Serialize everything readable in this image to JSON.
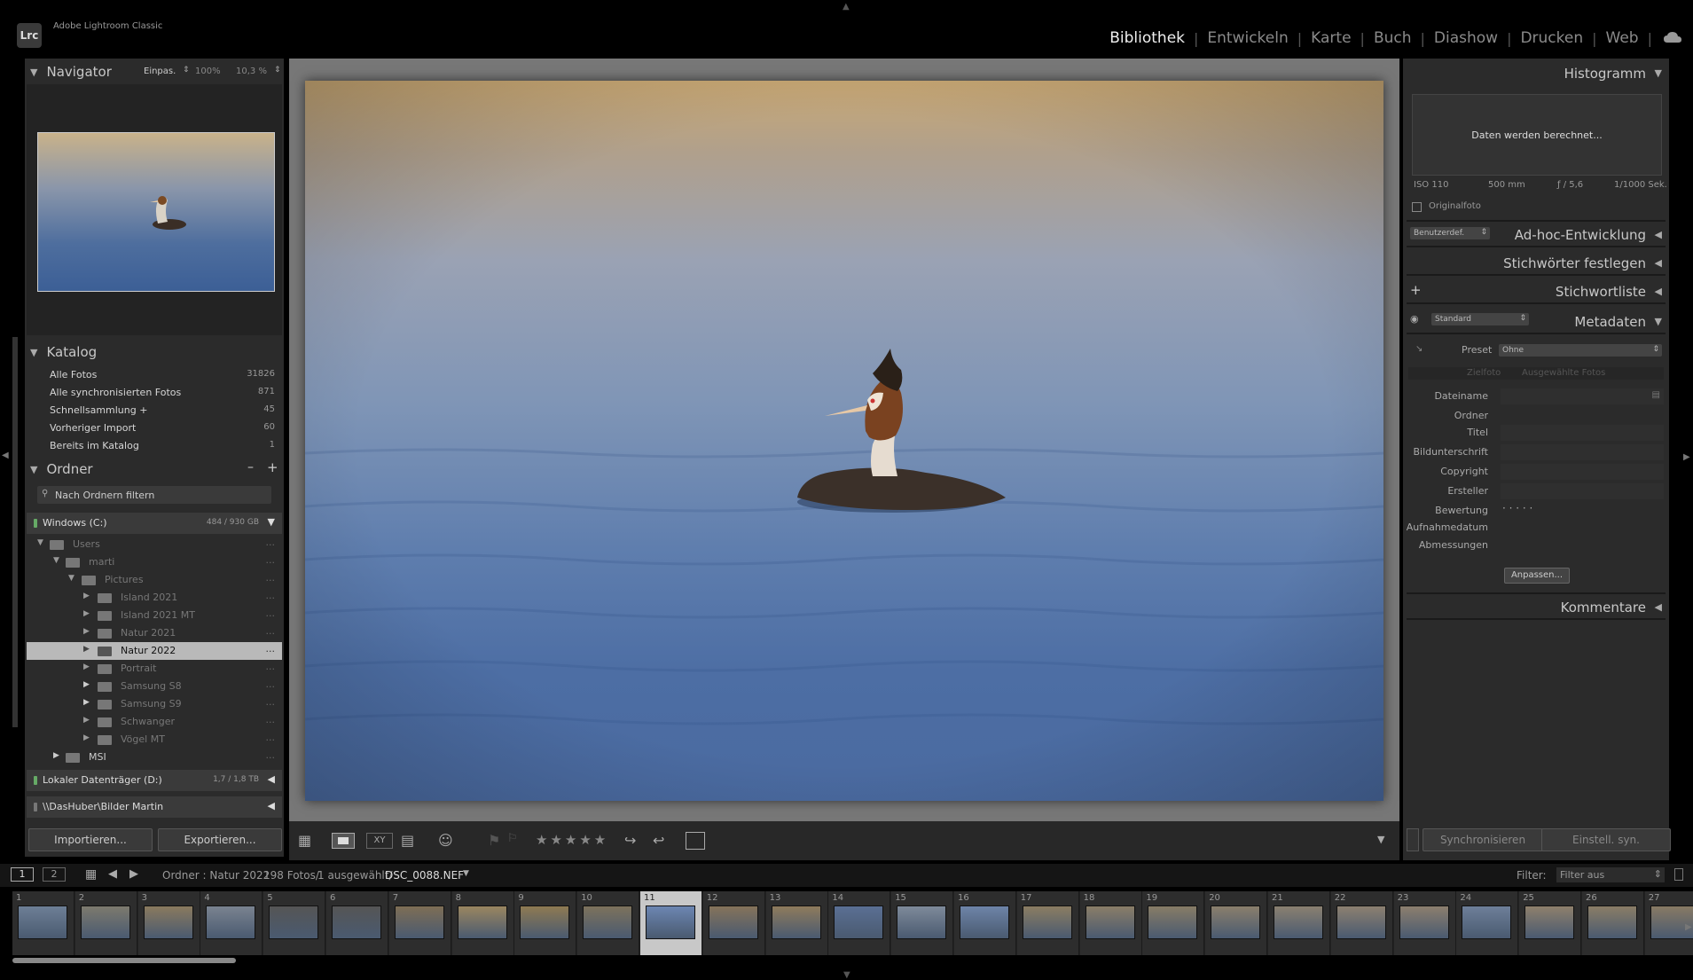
{
  "app": {
    "name": "Adobe Lightroom Classic",
    "logo": "Lrc"
  },
  "modules": [
    "Bibliothek",
    "Entwickeln",
    "Karte",
    "Buch",
    "Diashow",
    "Drucken",
    "Web"
  ],
  "active_module": "Bibliothek",
  "navigator": {
    "title": "Navigator",
    "fit": "Einpas.",
    "zoom1": "100%",
    "zoom2": "10,3 %"
  },
  "catalog": {
    "title": "Katalog",
    "items": [
      {
        "label": "Alle Fotos",
        "count": "31826"
      },
      {
        "label": "Alle synchronisierten Fotos",
        "count": "871"
      },
      {
        "label": "Schnellsammlung  +",
        "count": "45"
      },
      {
        "label": "Vorheriger Import",
        "count": "60"
      },
      {
        "label": "Bereits im Katalog",
        "count": "1"
      }
    ]
  },
  "folders": {
    "title": "Ordner",
    "minus": "–",
    "plus": "+",
    "filter_placeholder": "Nach Ordnern filtern",
    "volume_c": {
      "label": "Windows (C:)",
      "size": "484 / 930 GB"
    },
    "tree": [
      "Users",
      "marti",
      "Pictures",
      "Island 2021",
      "Island 2021 MT",
      "Natur 2021",
      "Natur 2022",
      "Portrait",
      "Samsung S8",
      "Samsung S9",
      "Schwanger",
      "Vögel MT",
      "MSI"
    ],
    "volume_d": {
      "label": "Lokaler Datenträger (D:)",
      "size": "1,7 / 1,8 TB"
    },
    "network": {
      "label": "\\\\DasHuber\\Bilder Martin"
    }
  },
  "buttons": {
    "import": "Importieren...",
    "export": "Exportieren...",
    "sync": "Synchronisieren",
    "sync_settings": "Einstell. syn."
  },
  "right": {
    "histogram": "Histogramm",
    "calc": "Daten werden berechnet...",
    "exif": {
      "iso": "ISO 110",
      "focal": "500 mm",
      "aperture": "ƒ / 5,6",
      "shutter": "1/1000 Sek."
    },
    "original": "Originalfoto",
    "quick_preset": "Benutzerdef.",
    "quick_dev": "Ad-hoc-Entwicklung",
    "keywording": "Stichwörter festlegen",
    "keyword_list": "Stichwortliste",
    "metadata": "Metadaten",
    "meta_view": "Standard",
    "preset_label": "Preset",
    "preset_value": "Ohne",
    "tab_target": "Zielfoto",
    "tab_selected": "Ausgewählte Fotos",
    "fields": [
      "Dateiname",
      "Ordner",
      "Titel",
      "Bildunterschrift",
      "Copyright",
      "Ersteller",
      "Bewertung",
      "Aufnahmedatum",
      "Abmessungen"
    ],
    "rating_dots": "·  ·  ·  ·  ·",
    "customize": "Anpassen...",
    "comments": "Kommentare"
  },
  "filmstrip": {
    "page1": "1",
    "page2": "2",
    "path": "Ordner : Natur 2022",
    "count": "198 Fotos/",
    "selected": "1 ausgewählt/",
    "file": "DSC_0088.NEF",
    "filter_label": "Filter:",
    "filter_value": "Filter aus",
    "numbers": [
      "1",
      "2",
      "3",
      "4",
      "5",
      "6",
      "7",
      "8",
      "9",
      "10",
      "11",
      "12",
      "13",
      "14",
      "15",
      "16",
      "17",
      "18",
      "19",
      "20",
      "21",
      "22",
      "23",
      "24",
      "25",
      "26",
      "27"
    ],
    "selected_index": 11
  },
  "colors": {
    "bg": "#000000",
    "panel": "#2b2b2b",
    "center": "#777777",
    "accent": "#eeeeee"
  }
}
